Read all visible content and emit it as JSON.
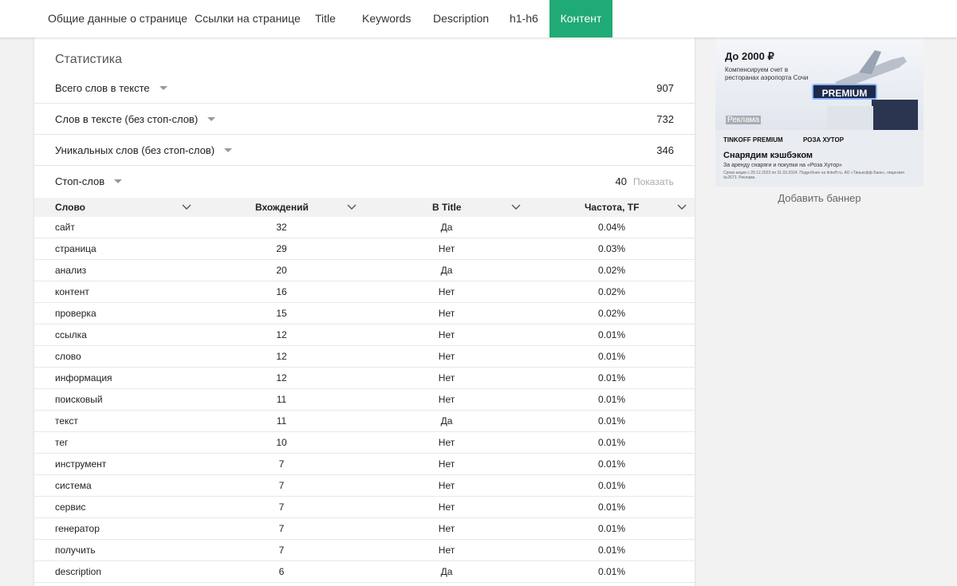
{
  "nav": {
    "tabs": [
      {
        "label": "Общие данные о странице"
      },
      {
        "label": "Ссылки на странице"
      },
      {
        "label": "Title"
      },
      {
        "label": "Keywords"
      },
      {
        "label": "Description"
      },
      {
        "label": "h1-h6"
      },
      {
        "label": "Контент",
        "active": true
      }
    ]
  },
  "stats": {
    "title": "Статистика",
    "rows": [
      {
        "label": "Всего слов в тексте",
        "value": "907"
      },
      {
        "label": "Слов в тексте (без стоп-слов)",
        "value": "732"
      },
      {
        "label": "Уникальных слов (без стоп-слов)",
        "value": "346"
      },
      {
        "label": "Стоп-слов",
        "value": "40",
        "link": "Показать"
      }
    ]
  },
  "table": {
    "headers": [
      "Слово",
      "Вхождений",
      "В Title",
      "Частота, TF"
    ],
    "rows": [
      [
        "сайт",
        "32",
        "Да",
        "0.04%"
      ],
      [
        "страница",
        "29",
        "Нет",
        "0.03%"
      ],
      [
        "анализ",
        "20",
        "Да",
        "0.02%"
      ],
      [
        "контент",
        "16",
        "Нет",
        "0.02%"
      ],
      [
        "проверка",
        "15",
        "Нет",
        "0.02%"
      ],
      [
        "ссылка",
        "12",
        "Нет",
        "0.01%"
      ],
      [
        "слово",
        "12",
        "Нет",
        "0.01%"
      ],
      [
        "информация",
        "12",
        "Нет",
        "0.01%"
      ],
      [
        "поисковый",
        "11",
        "Нет",
        "0.01%"
      ],
      [
        "текст",
        "11",
        "Да",
        "0.01%"
      ],
      [
        "тег",
        "10",
        "Нет",
        "0.01%"
      ],
      [
        "инструмент",
        "7",
        "Нет",
        "0.01%"
      ],
      [
        "система",
        "7",
        "Нет",
        "0.01%"
      ],
      [
        "сервис",
        "7",
        "Нет",
        "0.01%"
      ],
      [
        "генератор",
        "7",
        "Нет",
        "0.01%"
      ],
      [
        "получить",
        "7",
        "Нет",
        "0.01%"
      ],
      [
        "description",
        "6",
        "Да",
        "0.01%"
      ]
    ]
  },
  "ad": {
    "headline": "До 2000 ₽",
    "subtext": "Компенсируем счет в ресторанах аэропорта Сочи",
    "badge": "PREMIUM",
    "label": "Реклама",
    "brand1": "TINKOFF PREMIUM",
    "brand2": "РОЗА ХУТОР",
    "headline2": "Снарядим кэшбэком",
    "subtext2": "За аренду снаряги и покупки на «Роза Хутор»",
    "fineprint": "Сроки акции с 29.12.2023 по 31.03.2024. Подробнее на tinkoff.ru. АО «Тинькофф Банк», лицензия №2673. Реклама."
  },
  "sidebar": {
    "add_banner": "Добавить баннер"
  },
  "colors": {
    "accent": "#1faa76",
    "background": "#f2f2f2",
    "panel": "#ffffff"
  }
}
